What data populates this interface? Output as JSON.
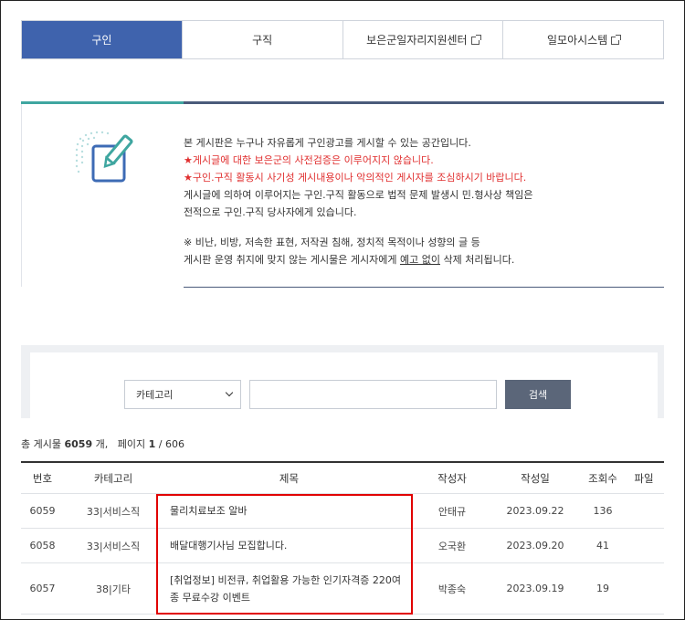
{
  "tabs": [
    {
      "label": "구인",
      "active": true,
      "external": false
    },
    {
      "label": "구직",
      "active": false,
      "external": false
    },
    {
      "label": "보은군일자리지원센터",
      "active": false,
      "external": true
    },
    {
      "label": "일모아시스템",
      "active": false,
      "external": true
    }
  ],
  "notice": {
    "line1": "본 게시판은 누구나 자유롭게 구인광고를 게시할 수 있는 공간입니다.",
    "line2": "★게시글에 대한 보은군의 사전검증은 이루어지지 않습니다.",
    "line3": "★구인.구직 활동시 사기성 게시내용이나 악의적인 게시자를 조심하시기 바랍니다.",
    "line4": "게시글에 의하여 이루어지는 구인.구직 활동으로 법적 문제 발생시 민.형사상 책임은",
    "line5": "전적으로 구인.구직 당사자에게 있습니다.",
    "line6": "※ 비난, 비방, 저속한 표현, 저작권 침해, 정치적 목적이나 성향의 글 등",
    "line7_pre": "게시판 운영 취지에 맞지 않는 게시물은 게시자에게 ",
    "line7_u": "예고 없이",
    "line7_post": " 삭제 처리됩니다.",
    "accent_red": "#e02f2f"
  },
  "search": {
    "category_selected": "카테고리",
    "query_value": "",
    "button_label": "검색"
  },
  "summary": {
    "total_prefix": "총 게시물",
    "total_count": "6059",
    "total_suffix": "개,",
    "page_prefix": "페이지",
    "page_current": "1",
    "page_total": "/ 606"
  },
  "table": {
    "headers": {
      "no": "번호",
      "category": "카테고리",
      "title": "제목",
      "author": "작성자",
      "date": "작성일",
      "views": "조회수",
      "file": "파일"
    },
    "rows": [
      {
        "no": "6059",
        "category": "33|서비스직",
        "title": "물리치료보조 알바",
        "author": "안태규",
        "date": "2023.09.22",
        "views": "136",
        "file": ""
      },
      {
        "no": "6058",
        "category": "33|서비스직",
        "title": "배달대행기사님 모집합니다.",
        "author": "오국환",
        "date": "2023.09.20",
        "views": "41",
        "file": ""
      },
      {
        "no": "6057",
        "category": "38|기타",
        "title_line1": "[취업정보] 비전큐, 취업활용 가능한 인기자격증 220여",
        "title_line2": "종 무료수강 이벤트",
        "author": "박종숙",
        "date": "2023.09.19",
        "views": "19",
        "file": ""
      }
    ]
  },
  "colors": {
    "active_tab": "#3f63ad",
    "teal_accent": "#3fa6a0",
    "search_button": "#5b6679",
    "highlight": "#e10000"
  },
  "icons": {
    "notice": "edit-document-icon",
    "external": "external-link-icon",
    "dropdown": "chevron-down-icon"
  }
}
